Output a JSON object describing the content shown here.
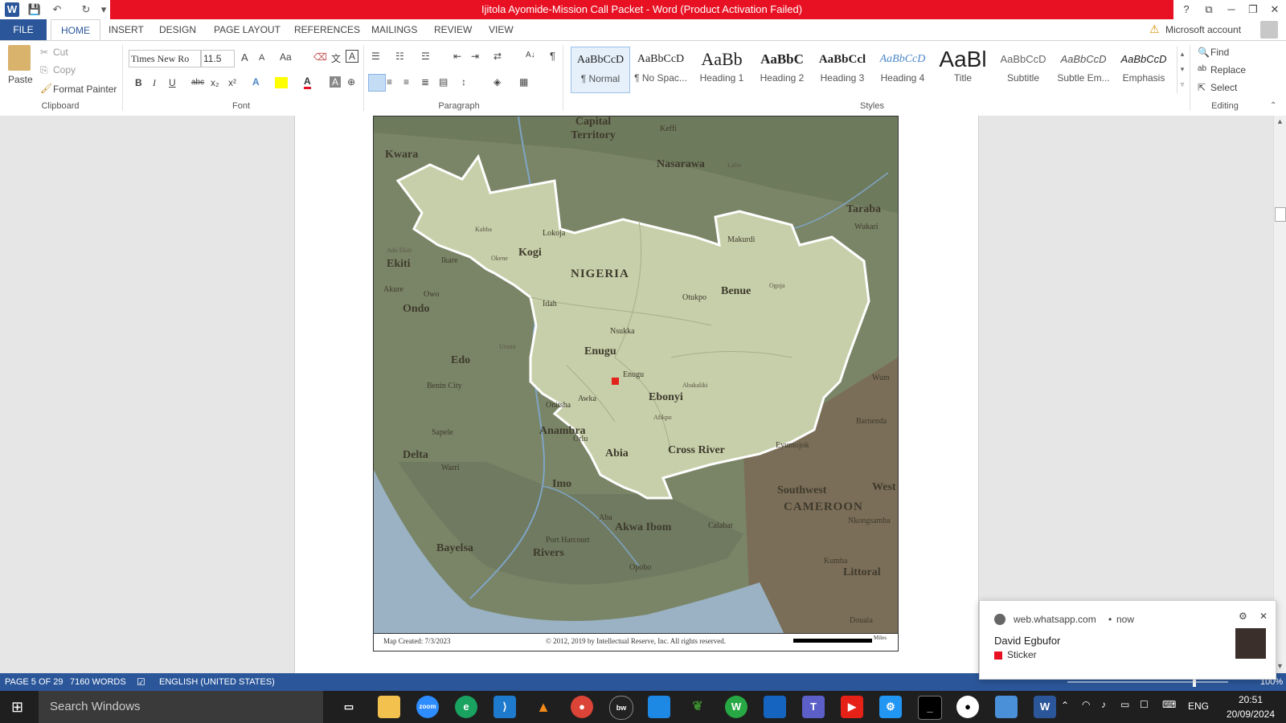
{
  "window": {
    "title": "Ijitola Ayomide-Mission Call Packet  -  Word (Product Activation Failed)",
    "help": "?",
    "controls": {
      "ribbon_display": "⧉",
      "minimize": "─",
      "restore": "❐",
      "close": "✕"
    }
  },
  "quick_access": {
    "app_icon": "W",
    "save": "💾",
    "undo": "↶",
    "redo": "↻",
    "customize": "▾"
  },
  "tabs": [
    {
      "label": "FILE"
    },
    {
      "label": "HOME"
    },
    {
      "label": "INSERT"
    },
    {
      "label": "DESIGN"
    },
    {
      "label": "PAGE LAYOUT"
    },
    {
      "label": "REFERENCES"
    },
    {
      "label": "MAILINGS"
    },
    {
      "label": "REVIEW"
    },
    {
      "label": "VIEW"
    }
  ],
  "account": {
    "label": "Microsoft account",
    "warning_icon": "⚠"
  },
  "clipboard": {
    "paste": "Paste",
    "cut": "Cut",
    "copy": "Copy",
    "format_painter": "Format Painter",
    "group_label": "Clipboard"
  },
  "font": {
    "name": "Times New Ro",
    "size": "11.5",
    "group_label": "Font",
    "grow": "A",
    "shrink": "A",
    "case": "Aa",
    "bold": "B",
    "italic": "I",
    "underline": "U",
    "strike": "abc",
    "subscript": "x₂",
    "superscript": "x²"
  },
  "paragraph": {
    "group_label": "Paragraph",
    "pilcrow": "¶",
    "sort": "A↓"
  },
  "styles": {
    "group_label": "Styles",
    "items": [
      {
        "sample": "AaBbCcD",
        "name": "¶ Normal"
      },
      {
        "sample": "AaBbCcD",
        "name": "¶ No Spac..."
      },
      {
        "sample": "AaBb",
        "name": "Heading 1"
      },
      {
        "sample": "AaBbC",
        "name": "Heading 2"
      },
      {
        "sample": "AaBbCcl",
        "name": "Heading 3"
      },
      {
        "sample": "AaBbCcD",
        "name": "Heading 4"
      },
      {
        "sample": "AaBl",
        "name": "Title"
      },
      {
        "sample": "AaBbCcD",
        "name": "Subtitle"
      },
      {
        "sample": "AaBbCcD",
        "name": "Subtle Em..."
      },
      {
        "sample": "AaBbCcD",
        "name": "Emphasis"
      }
    ]
  },
  "editing": {
    "group_label": "Editing",
    "find": "Find",
    "replace": "Replace",
    "select": "Select"
  },
  "map": {
    "country": "NIGERIA",
    "states": [
      "Kogi",
      "Benue",
      "Enugu",
      "Ebonyi",
      "Cross River",
      "Anambra",
      "Abia",
      "Imo",
      "Edo",
      "Ondo",
      "Ekiti",
      "Delta",
      "Bayelsa",
      "Rivers",
      "Akwa Ibom",
      "Nasarawa",
      "Taraba",
      "Kwara"
    ],
    "regions": [
      "Capital Territory",
      "Southwest",
      "CAMEROON",
      "Littoral",
      "West"
    ],
    "cities": [
      "Keffi",
      "Lafia",
      "Wukari",
      "Makurdi",
      "Lokoja",
      "Kabba",
      "Okene",
      "Ado Ekiti",
      "Ikare",
      "Akure",
      "Owo",
      "Idah",
      "Otukpo",
      "Nsukka",
      "Enugu",
      "Awka",
      "Onitsha",
      "Abakaliki",
      "Benin City",
      "Sapele",
      "Warri",
      "Orlu",
      "Aba",
      "Port Harcourt",
      "Opobo",
      "Calabar",
      "Eyumojok",
      "Barnenda",
      "Kumba",
      "Douala",
      "Nkongsamba",
      "Ogoja",
      "Wum",
      "Afikpo",
      "Uromi"
    ],
    "footer_created": "Map Created: 7/3/2023",
    "footer_copyright": "© 2012, 2019 by Intellectual Reserve, Inc. All rights reserved.",
    "footer_scale": "Miles"
  },
  "status": {
    "page": "PAGE 5 OF 29",
    "words": "7160 WORDS",
    "language": "ENGLISH (UNITED STATES)",
    "zoom": "100%"
  },
  "notification": {
    "source": "web.whatsapp.com",
    "time": "now",
    "sender": "David Egbufor",
    "message": "Sticker"
  },
  "taskbar": {
    "search_placeholder": "Search Windows",
    "language": "ENG",
    "time": "20:51",
    "date": "20/09/2024"
  }
}
